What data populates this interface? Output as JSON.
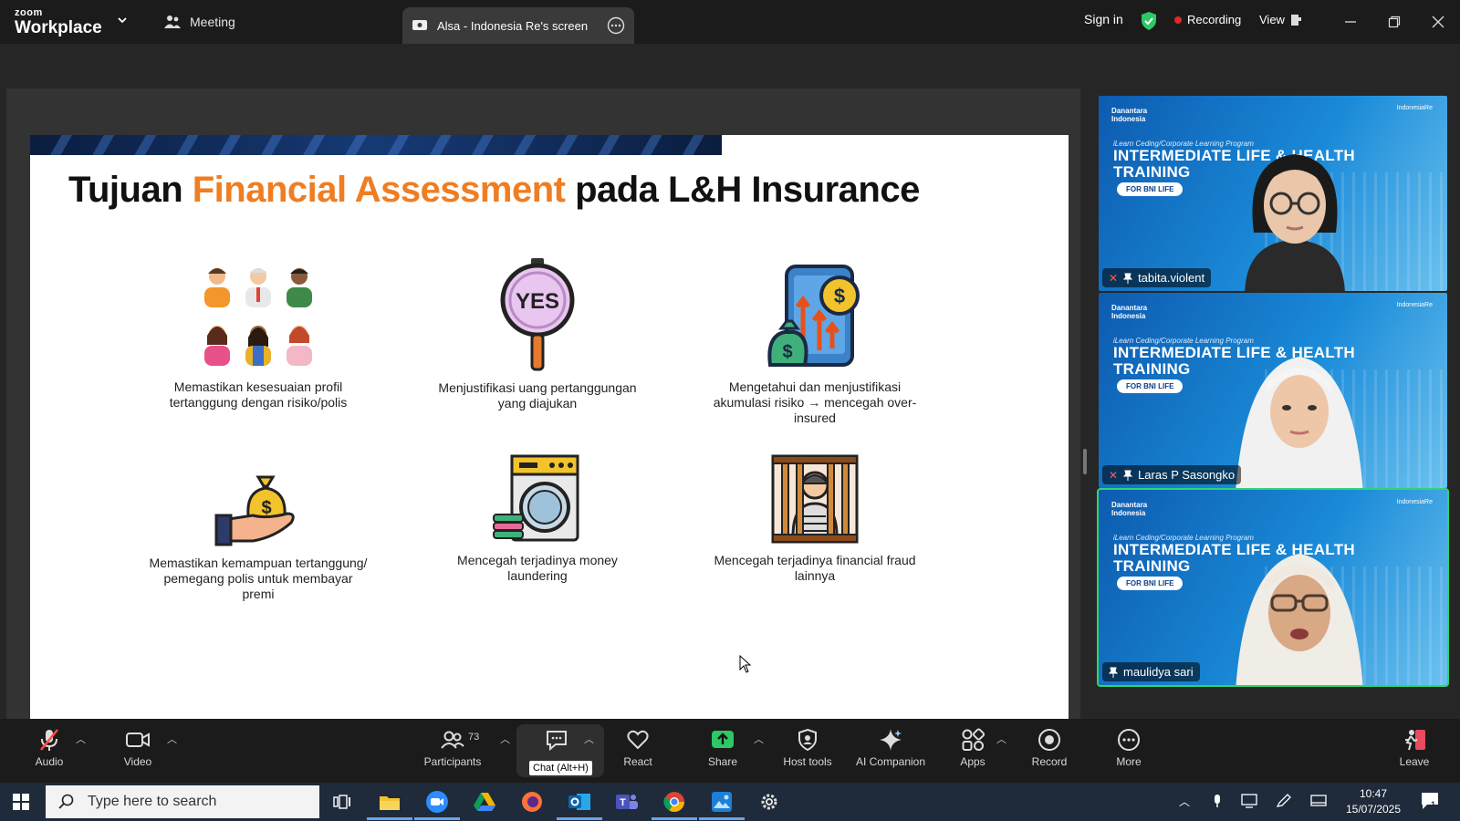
{
  "app": {
    "brand_top": "zoom",
    "brand_bottom": "Workplace"
  },
  "topbar": {
    "meeting_label": "Meeting",
    "active_tab_label": "Alsa - Indonesia Re's screen",
    "signin_label": "Sign in",
    "recording_label": "Recording",
    "view_label": "View"
  },
  "slide": {
    "title_pre": "Tujuan ",
    "title_highlight": "Financial Assessment",
    "title_post": " pada L&H Insurance",
    "accent_color": "#ef7d22",
    "items": [
      {
        "icon": "people-group-icon",
        "caption": "Memastikan kesesuaian profil tertanggung dengan risiko/polis"
      },
      {
        "icon": "yes-magnifier-icon",
        "caption": "Menjustifikasi uang pertanggungan yang diajukan"
      },
      {
        "icon": "money-growth-icon",
        "caption": "Mengetahui dan menjustifikasi akumulasi risiko → mencegah over-insured"
      },
      {
        "icon": "hand-money-bag-icon",
        "caption": "Memastikan kemampuan tertanggung/ pemegang polis untuk membayar premi"
      },
      {
        "icon": "washing-machine-money-icon",
        "caption": "Mencegah terjadinya money laundering"
      },
      {
        "icon": "prisoner-icon",
        "caption": "Mencegah terjadinya financial fraud lainnya"
      }
    ]
  },
  "participants_video": [
    {
      "name": "tabita.violent",
      "muted": true,
      "speaking": false
    },
    {
      "name": "Laras P Sasongko",
      "muted": true,
      "speaking": false
    },
    {
      "name": "maulidya sari",
      "muted": false,
      "speaking": true
    }
  ],
  "tile_branding": {
    "org_left_1": "Danantara",
    "org_left_2": "Indonesia",
    "org_right": "IndonesiaRe",
    "program_line": "iLearn Ceding/Corporate Learning Program",
    "headline_1": "INTERMEDIATE LIFE & HEALTH",
    "headline_2": "TRAINING",
    "pill": "FOR BNI LIFE"
  },
  "toolbar": {
    "audio": "Audio",
    "video": "Video",
    "participants": "Participants",
    "participant_count": "73",
    "chat_tooltip": "Chat (Alt+H)",
    "react": "React",
    "share": "Share",
    "host_tools": "Host tools",
    "ai_companion": "AI Companion",
    "apps": "Apps",
    "record": "Record",
    "more": "More",
    "leave": "Leave"
  },
  "taskbar": {
    "search_placeholder": "Type here to search",
    "time": "10:47",
    "date": "15/07/2025",
    "notification_count": "1"
  }
}
